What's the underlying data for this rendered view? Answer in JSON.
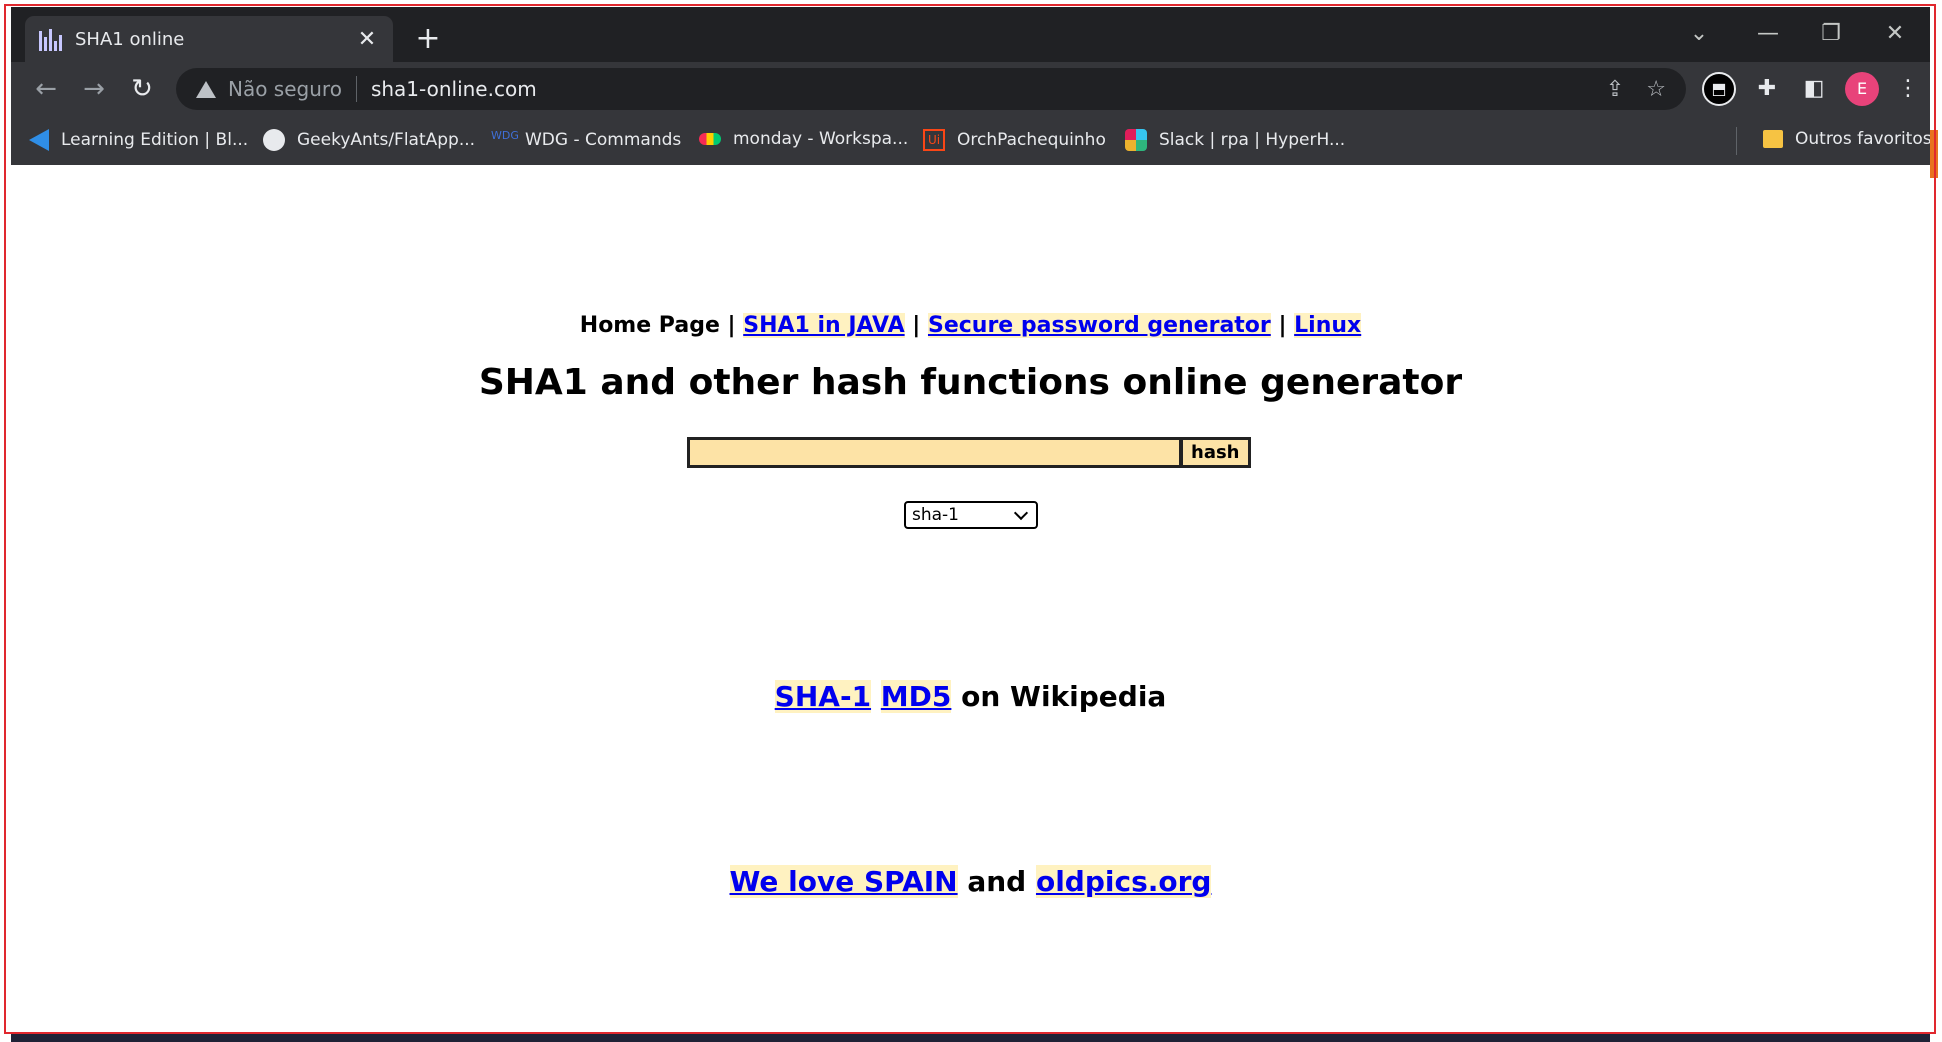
{
  "tab": {
    "title": "SHA1 online",
    "close": "✕"
  },
  "newtab": "+",
  "window": {
    "tabsearch": "⌄",
    "minimize": "—",
    "restore": "❐",
    "close": "✕"
  },
  "nav": {
    "back": "←",
    "forward": "→",
    "reload": "↻"
  },
  "omnibox": {
    "security": "Não seguro",
    "url": "sha1-online.com"
  },
  "profile_initial": "E",
  "bookmarks": [
    {
      "label": "Learning Edition | Bl..."
    },
    {
      "label": "GeekyAnts/FlatApp..."
    },
    {
      "label": "WDG - Commands"
    },
    {
      "label": "monday - Workspa..."
    },
    {
      "label": "OrchPachequinho"
    },
    {
      "label": "Slack | rpa | HyperH..."
    },
    {
      "label": "Outros favoritos"
    }
  ],
  "page": {
    "nav": {
      "home": "Home Page",
      "sep": " | ",
      "java": "SHA1 in JAVA",
      "pwgen": "Secure password generator",
      "linux": "Linux"
    },
    "headline": "SHA1 and other hash functions online generator",
    "input_value": "",
    "hash_button": "hash",
    "algorithm": "sha-1",
    "wiki": {
      "sha1": "SHA-1",
      "md5": "MD5",
      "suffix": "on Wikipedia"
    },
    "spain": {
      "link1": "We love SPAIN",
      "mid": "and",
      "link2": "oldpics.org"
    }
  },
  "colors": {
    "link": "#0000ee",
    "link_bg": "#fff2c1",
    "input_bg": "#fde3a6",
    "chrome_dark": "#202124",
    "chrome_tab": "#35363a"
  }
}
